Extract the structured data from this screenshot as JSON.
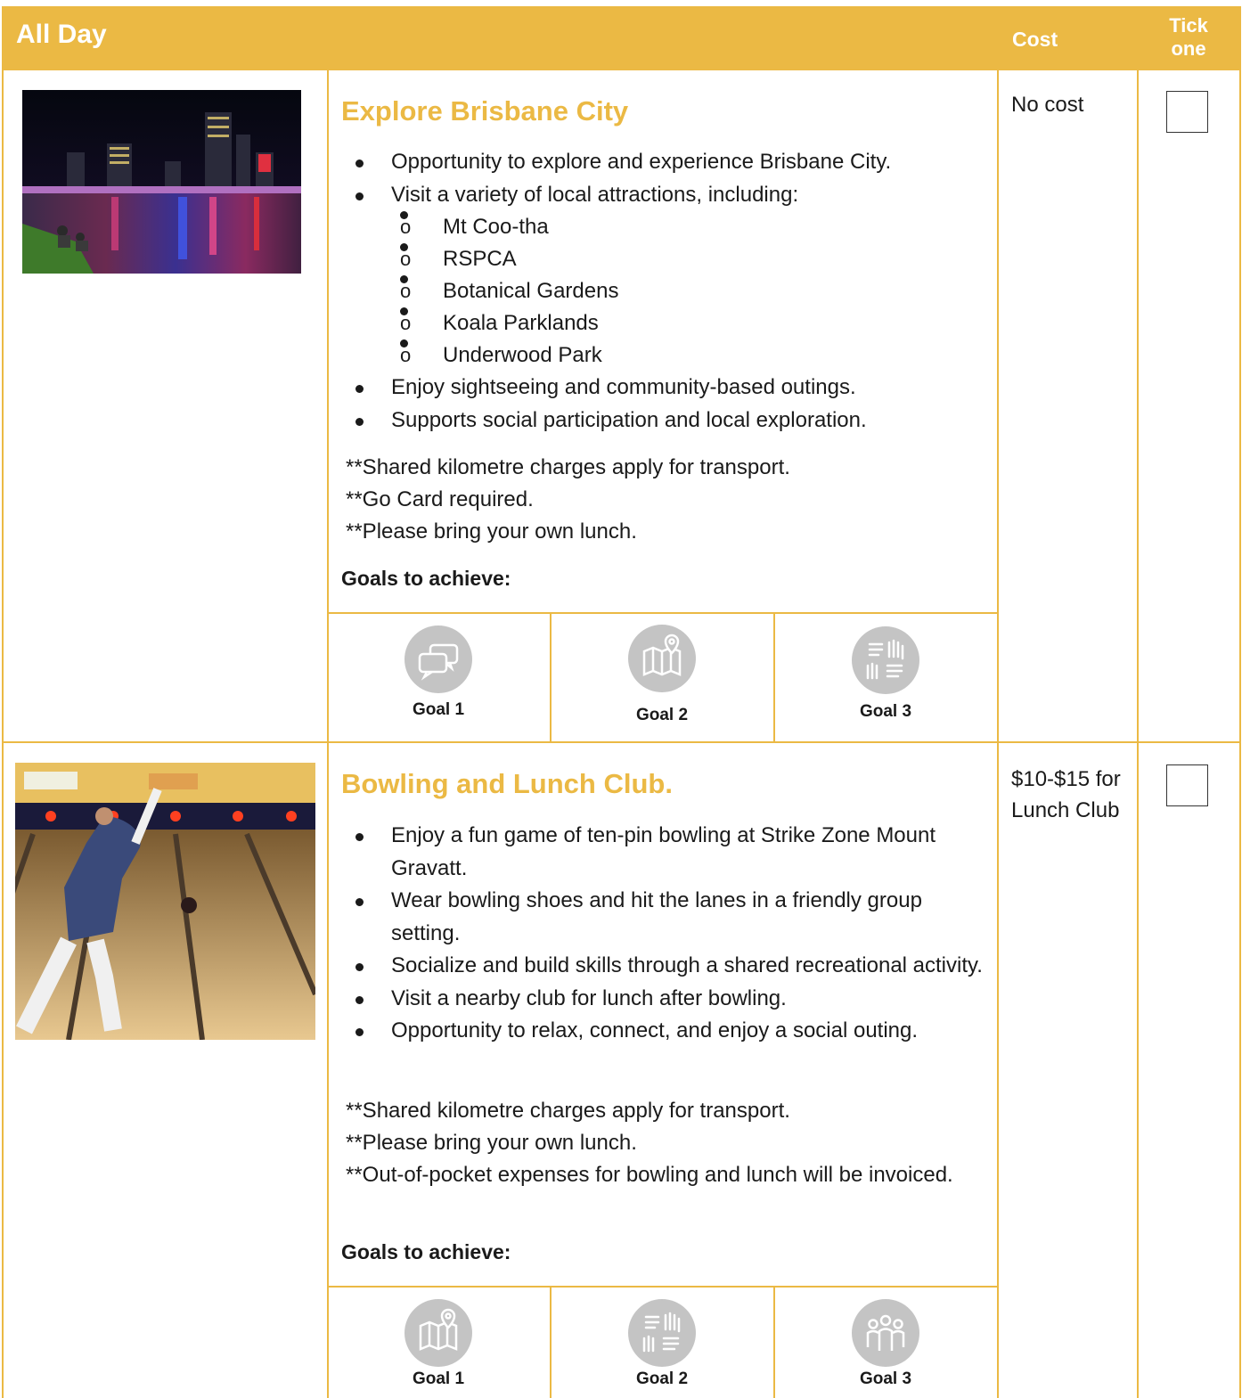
{
  "header": {
    "title": "All Day",
    "cost_label": "Cost",
    "tick_label": "Tick one"
  },
  "activities": [
    {
      "title": "Explore Brisbane City",
      "bullets": [
        "Opportunity to explore and experience Brisbane City.",
        "Visit a variety of local attractions, including:"
      ],
      "sub_items": [
        "Mt Coo-tha",
        "RSPCA",
        "Botanical Gardens",
        "Koala Parklands",
        "Underwood Park"
      ],
      "bullets_after": [
        "Enjoy sightseeing and community-based outings.",
        "Supports social participation and local exploration."
      ],
      "notes": [
        "**Shared kilometre charges apply for transport.",
        "**Go Card required.",
        "**Please bring your own lunch."
      ],
      "goals_label": "Goals to achieve:",
      "goals": [
        {
          "label": "Goal 1",
          "icon": "speech-bubbles-icon"
        },
        {
          "label": "Goal 2",
          "icon": "map-pin-icon"
        },
        {
          "label": "Goal 3",
          "icon": "hands-together-icon"
        }
      ],
      "cost": "No cost"
    },
    {
      "title": "Bowling and Lunch Club.",
      "bullets": [
        "Enjoy a fun game of ten-pin bowling at Strike Zone Mount Gravatt.",
        "Wear bowling shoes and hit the lanes in a friendly group setting.",
        "Socialize and build skills through a shared recreational activity.",
        "Visit a nearby club for lunch after bowling.",
        "Opportunity to relax, connect, and enjoy a social outing."
      ],
      "notes": [
        "**Shared kilometre charges apply for transport.",
        "**Please bring your own lunch.",
        "**Out-of-pocket expenses for bowling and lunch will be invoiced."
      ],
      "goals_label": "Goals to achieve:",
      "goals": [
        {
          "label": "Goal 1",
          "icon": "map-pin-icon"
        },
        {
          "label": "Goal 2",
          "icon": "hands-together-icon"
        },
        {
          "label": "Goal 3",
          "icon": "people-group-icon"
        }
      ],
      "cost": "$10-$15 for Lunch Club"
    }
  ],
  "colors": {
    "accent": "#ebb944",
    "icon_gray": "#c4c4c4"
  }
}
